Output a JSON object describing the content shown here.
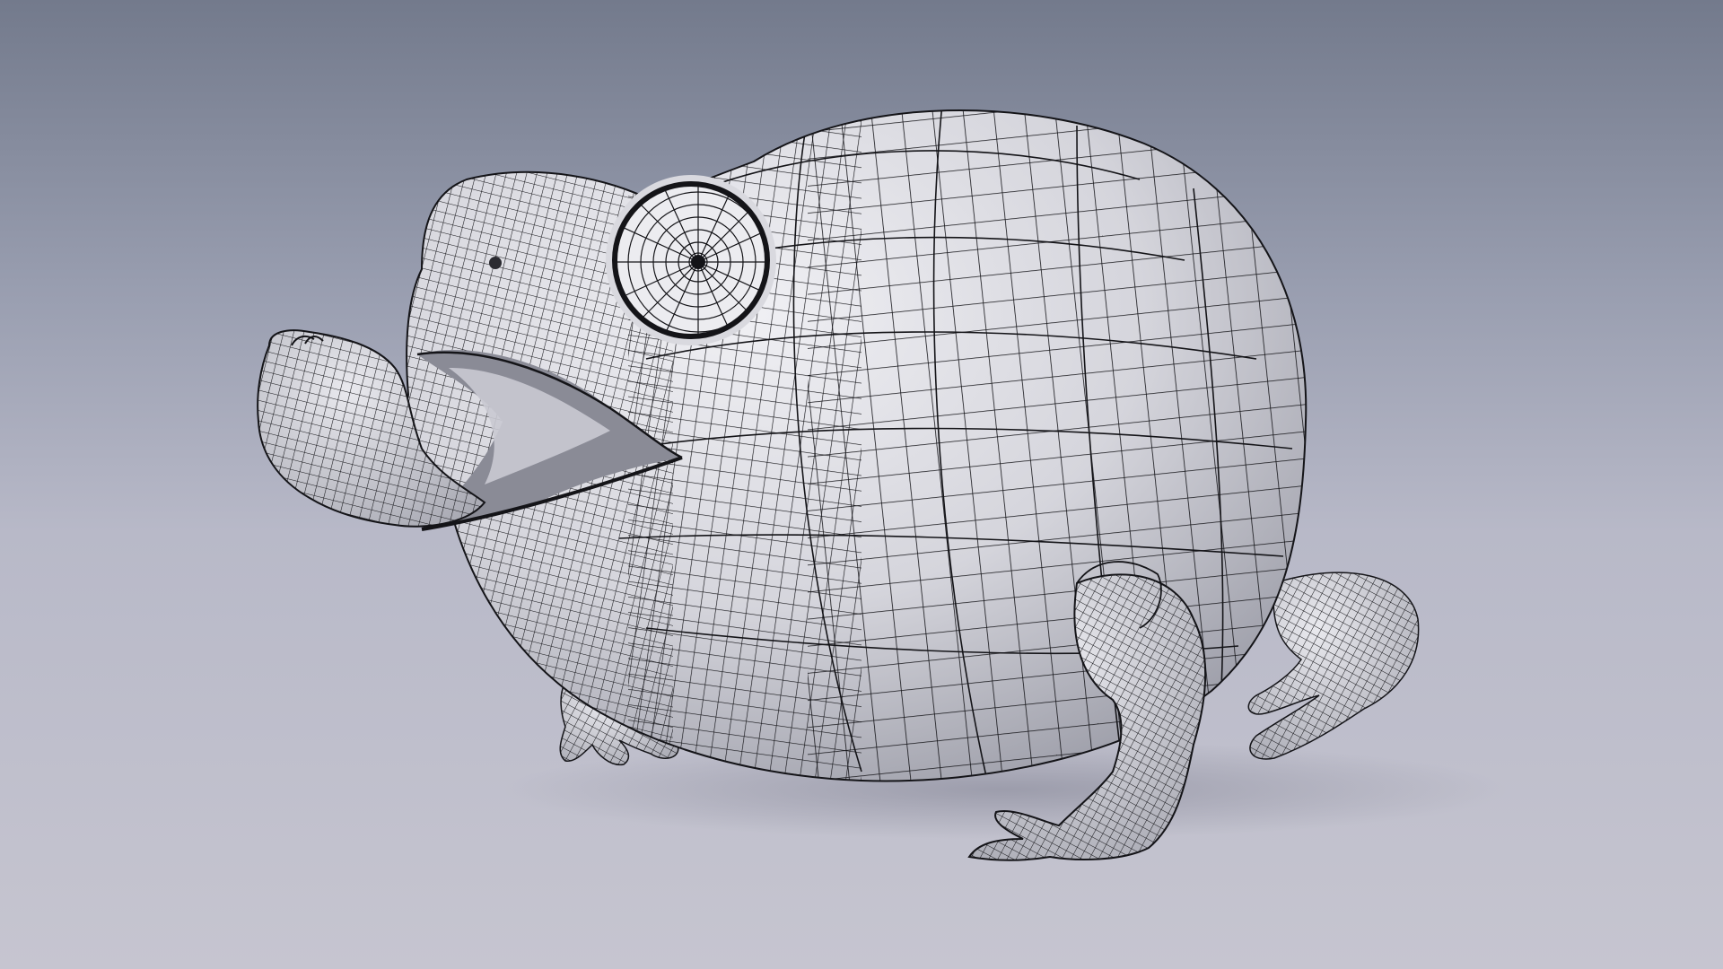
{
  "scene": {
    "subject": "frog-3d-wireframe-render",
    "render_style": "clay shading with quad wireframe overlay",
    "colors": {
      "background_top": "#737a8c",
      "background_mid": "#a8abba",
      "background_bottom": "#c6c5d0",
      "surface_light": "#efeff3",
      "surface_mid": "#c8c8d0",
      "surface_dark": "#8f909c",
      "wire": "#141418",
      "mouth_shadow": "#6d6e78"
    }
  }
}
